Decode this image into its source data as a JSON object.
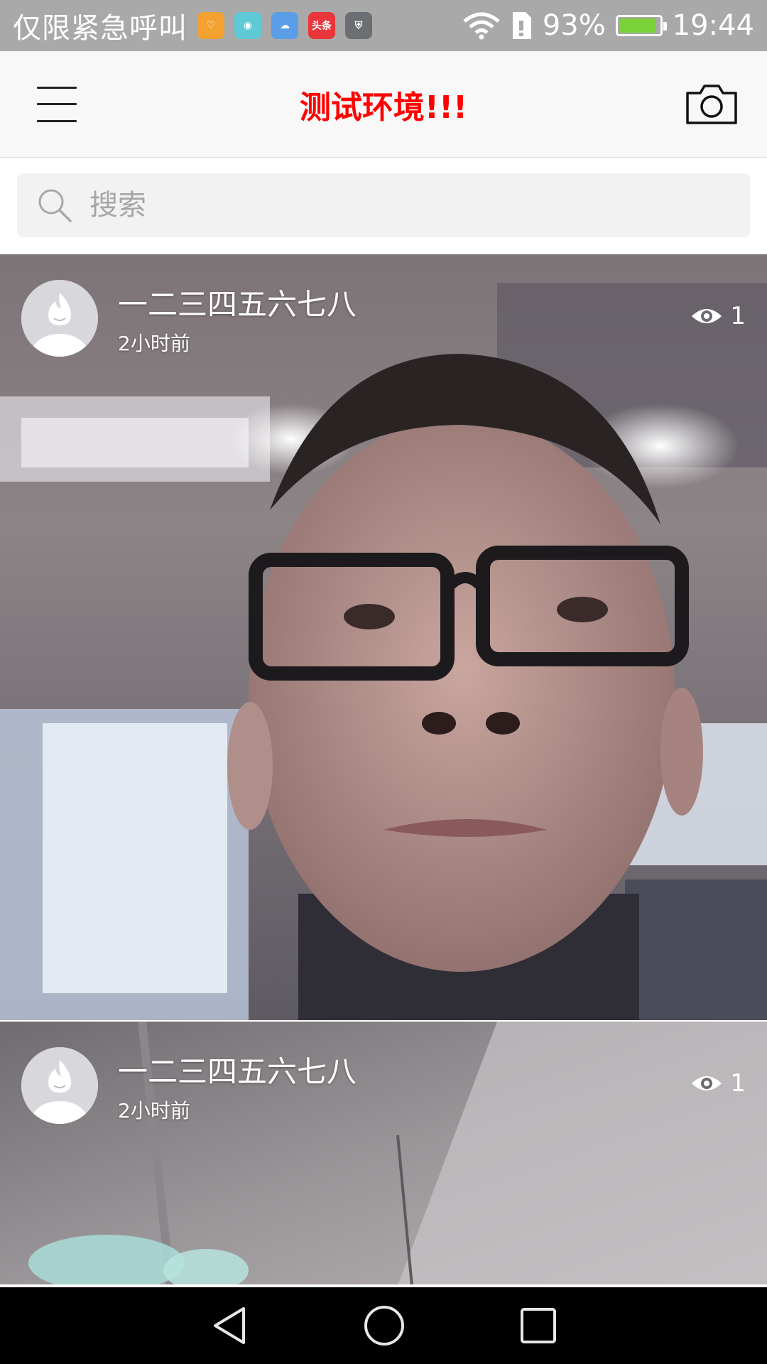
{
  "status_bar": {
    "carrier": "仅限紧急呼叫",
    "notification_icons": [
      {
        "name": "health-app-icon",
        "color": "#f3a232",
        "glyph": "♡"
      },
      {
        "name": "android-icon",
        "color": "#5fc9d6",
        "glyph": "◉"
      },
      {
        "name": "cloud-icon",
        "color": "#5a9ee8",
        "glyph": "☁"
      },
      {
        "name": "toutiao-icon",
        "color": "#e8363a",
        "glyph": "头条"
      },
      {
        "name": "shield-icon",
        "color": "#6b6f73",
        "glyph": "⛨"
      }
    ],
    "battery_percent": "93%",
    "battery_level": 0.93,
    "time": "19:44"
  },
  "app_bar": {
    "title": "测试环境!!!",
    "title_color": "#ff0000"
  },
  "search": {
    "placeholder": "搜索"
  },
  "posts": [
    {
      "username": "一二三四五六七八",
      "time_ago": "2小时前",
      "views": "1"
    },
    {
      "username": "一二三四五六七八",
      "time_ago": "2小时前",
      "views": "1"
    }
  ]
}
